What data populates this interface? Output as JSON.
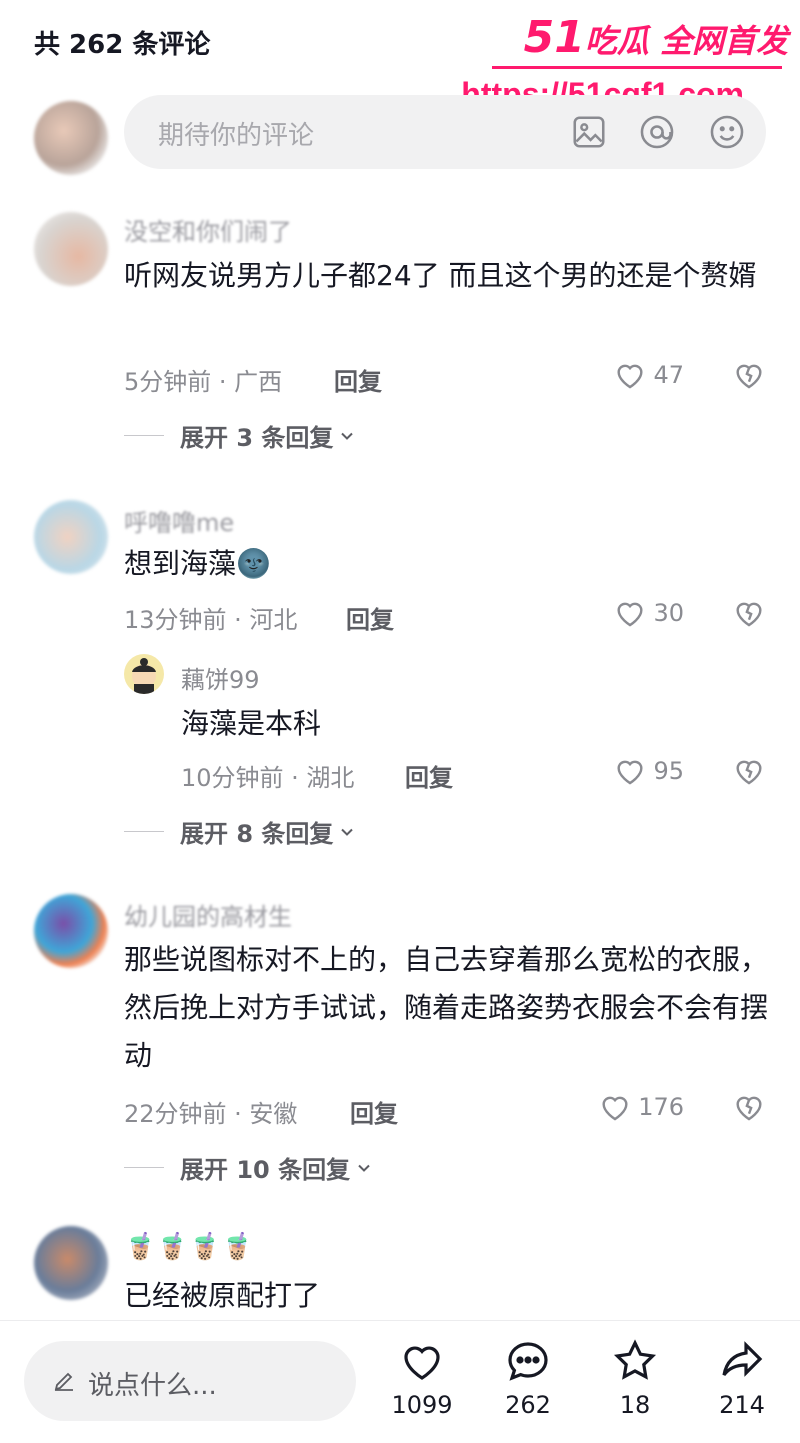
{
  "header": {
    "title": "共 262 条评论"
  },
  "watermark": {
    "brand_num": "51",
    "brand_text": "吃瓜 全网首发",
    "url": "https://51cgf1.com"
  },
  "composer": {
    "placeholder": "期待你的评论"
  },
  "comments": [
    {
      "username": "没空和你们闹了",
      "text": "听网友说男方儿子都24了 而且这个男的还是个赘婿",
      "time": "5分钟前 · 广西",
      "reply_label": "回复",
      "likes": "47",
      "expand": "展开 3 条回复"
    },
    {
      "username": "呼噜噜me",
      "text": "想到海藻🌚",
      "time": "13分钟前 · 河北",
      "reply_label": "回复",
      "likes": "30",
      "reply": {
        "username": "藕饼99",
        "text": "海藻是本科",
        "time": "10分钟前 · 湖北",
        "reply_label": "回复",
        "likes": "95"
      },
      "expand": "展开 8 条回复"
    },
    {
      "username": "幼儿园的高材生",
      "text": "那些说图标对不上的，自己去穿着那么宽松的衣服，然后挽上对方手试试，随着走路姿势衣服会不会有摆动",
      "time": "22分钟前 · 安徽",
      "reply_label": "回复",
      "likes": "176",
      "expand": "展开 10 条回复"
    },
    {
      "username": "🧋🧋🧋🧋",
      "text": "已经被原配打了"
    }
  ],
  "bottom_bar": {
    "say_placeholder": "说点什么...",
    "likes": "1099",
    "comments": "262",
    "favorites": "18",
    "shares": "214"
  }
}
